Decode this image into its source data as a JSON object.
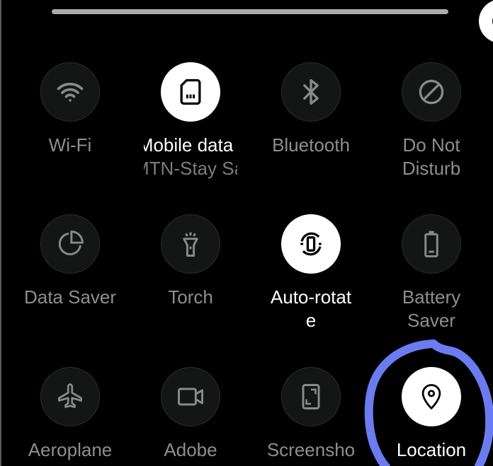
{
  "brightness": {
    "level_percent": 100
  },
  "tiles": [
    {
      "label": "Wi-Fi",
      "state": "off",
      "icon": "wifi-icon"
    },
    {
      "label": "Mobile data",
      "sublabel": "MTN-Stay Safe",
      "state": "on",
      "icon": "sim-card-icon"
    },
    {
      "label": "Bluetooth",
      "state": "off",
      "icon": "bluetooth-icon"
    },
    {
      "label": "Do Not",
      "label2": "Disturb",
      "state": "off",
      "icon": "do-not-disturb-icon"
    },
    {
      "label": "Data Saver",
      "state": "off",
      "icon": "data-saver-icon"
    },
    {
      "label": "Torch",
      "state": "off",
      "icon": "torch-icon"
    },
    {
      "label": "Auto-rotat",
      "label2": "e",
      "state": "on",
      "icon": "auto-rotate-icon"
    },
    {
      "label": "Battery",
      "label2": "Saver",
      "state": "off",
      "icon": "battery-icon"
    },
    {
      "label": "Aeroplane",
      "state": "off",
      "icon": "aeroplane-icon"
    },
    {
      "label": "Adobe",
      "state": "off",
      "icon": "video-camera-icon"
    },
    {
      "label": "Screensho",
      "state": "off",
      "icon": "screenshot-icon"
    },
    {
      "label": "Location",
      "state": "on",
      "icon": "location-pin-icon"
    }
  ],
  "colors": {
    "background": "#000000",
    "tile_off": "#141615",
    "tile_on": "#ffffff",
    "label_off": "#8e8e8e",
    "label_on": "#ffffff",
    "annotation": "#6b7cf0"
  }
}
